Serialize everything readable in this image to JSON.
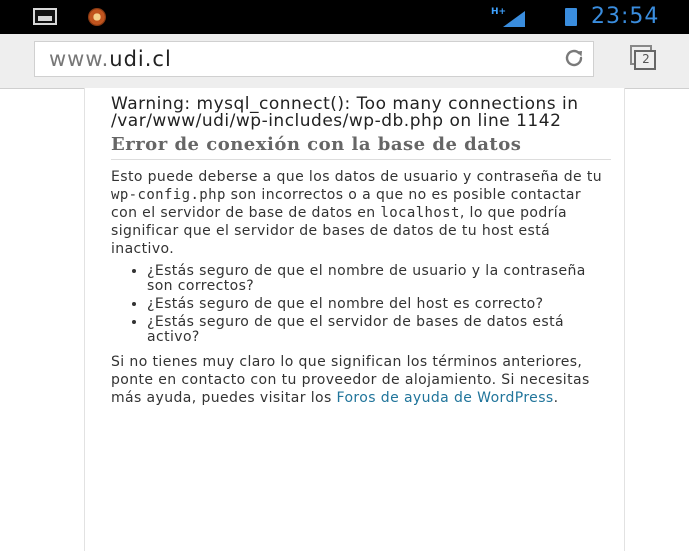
{
  "status_bar": {
    "network_type": "H+",
    "time": "23:54"
  },
  "url_bar": {
    "url_prefix": "www.",
    "url_domain": "udi.cl",
    "tab_count": "2"
  },
  "page": {
    "warning": "Warning: mysql_connect(): Too many connections in /var/www/udi/wp-includes/wp-db.php on line 1142",
    "heading": "Error de conexión con la base de datos",
    "intro_1": "Esto puede deberse a que los datos de usuario y contraseña de tu ",
    "intro_code_1": "wp-config.php",
    "intro_2": " son incorrectos o a que no es posible contactar con el servidor de base de datos en ",
    "intro_code_2": "localhost",
    "intro_3": ", lo que podría significar que el servidor de bases de datos de tu host está inactivo.",
    "questions": [
      "¿Estás seguro de que el nombre de usuario y la contraseña son correctos?",
      "¿Estás seguro de que el nombre del host es correcto?",
      "¿Estás seguro de que el servidor de bases de datos está activo?"
    ],
    "help_text": "Si no tienes muy claro lo que significan los términos anteriores, ponte en contacto con tu proveedor de alojamiento. Si necesitas más ayuda, puedes visitar los ",
    "help_link": "Foros de ayuda de WordPress",
    "help_end": "."
  }
}
